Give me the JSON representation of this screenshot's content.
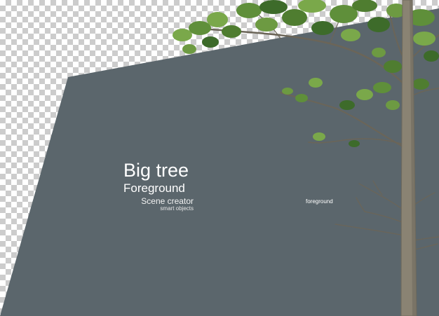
{
  "heading": {
    "title": "Big tree",
    "subtitle": "Foreground",
    "creator": "Scene creator",
    "tagline": "smart objects"
  },
  "label": "foreground",
  "colors": {
    "panel": "#5b666c",
    "checker_light": "#ffffff",
    "checker_dark": "#cccccc",
    "trunk": "#8a8373",
    "branch": "#6b6558",
    "leaf_dark": "#3d6b2a",
    "leaf_light": "#7aa84a"
  }
}
